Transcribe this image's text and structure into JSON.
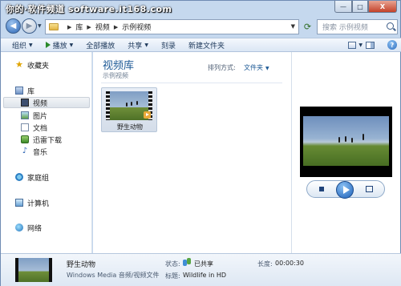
{
  "watermark": "你的·软件频道 software.it168.com",
  "window_controls": {
    "minimize": "—",
    "maximize": "□",
    "close": "X"
  },
  "address": {
    "crumbs": [
      "库",
      "视频",
      "示例视频"
    ],
    "search_placeholder": "搜索 示例视频"
  },
  "toolbar": {
    "organize": "组织",
    "play": "播放",
    "play_all": "全部播放",
    "share": "共享",
    "burn": "刻录",
    "new_folder": "新建文件夹"
  },
  "nav": {
    "favorites": "收藏夹",
    "libraries": "库",
    "videos": "视频",
    "pictures": "图片",
    "documents": "文档",
    "downloads": "迅雷下载",
    "music": "音乐",
    "homegroup": "家庭组",
    "computer": "计算机",
    "network": "网络"
  },
  "content": {
    "library_title": "视频库",
    "library_subtitle": "示例视频",
    "arrange_label": "排列方式:",
    "arrange_value": "文件夹",
    "file_name": "野生动物"
  },
  "details": {
    "title": "野生动物",
    "type": "Windows Media 音频/视频文件",
    "status_label": "状态:",
    "status_value": "已共享",
    "tags_label": "标题:",
    "tags_value": "Wildlife in HD",
    "length_label": "长度:",
    "length_value": "00:00:30"
  },
  "icons": {
    "back": "back-arrow-icon",
    "forward": "forward-arrow-icon",
    "refresh": "refresh-icon",
    "search": "search-icon",
    "help": "help-icon"
  },
  "colors": {
    "frame": "#c5d8ee",
    "accent": "#1e5a96",
    "close": "#c4412a"
  }
}
